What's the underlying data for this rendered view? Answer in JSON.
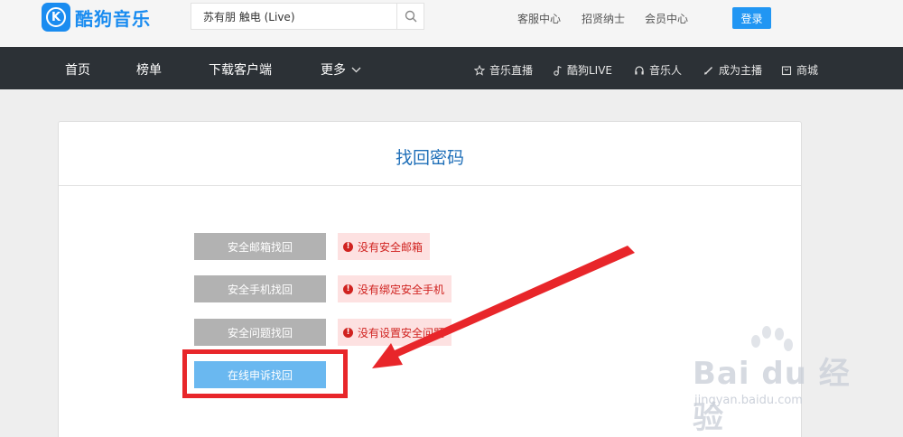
{
  "header": {
    "brand": "酷狗音乐",
    "logo_letter": "K",
    "search": {
      "value": "苏有朋 触电 (Live)",
      "placeholder": ""
    },
    "links": [
      "客服中心",
      "招贤纳士",
      "会员中心"
    ],
    "login_label": "登录"
  },
  "nav": {
    "items": [
      "首页",
      "榜单",
      "下载客户端",
      "更多"
    ],
    "right_items": [
      {
        "label": "音乐直播",
        "icon": "star-icon"
      },
      {
        "label": "酷狗LIVE",
        "icon": "music-note-icon"
      },
      {
        "label": "音乐人",
        "icon": "headphones-icon"
      },
      {
        "label": "成为主播",
        "icon": "edit-icon"
      },
      {
        "label": "商城",
        "icon": "store-icon"
      }
    ]
  },
  "card": {
    "title": "找回密码",
    "options": [
      {
        "label": "安全邮箱找回",
        "warning": "没有安全邮箱"
      },
      {
        "label": "安全手机找回",
        "warning": "没有绑定安全手机"
      },
      {
        "label": "安全问题找回",
        "warning": "没有设置安全问题"
      }
    ],
    "appeal_label": "在线申诉找回"
  },
  "watermark": {
    "text": "Bai du 经验",
    "sub": "jingyan.baidu.com"
  },
  "colors": {
    "brand": "#1a8cf0",
    "nav_bg": "#2c3136",
    "title": "#1f6fb8",
    "warning": "#d0221f",
    "appeal": "#6ab8f0",
    "annotation": "#e8262a"
  }
}
